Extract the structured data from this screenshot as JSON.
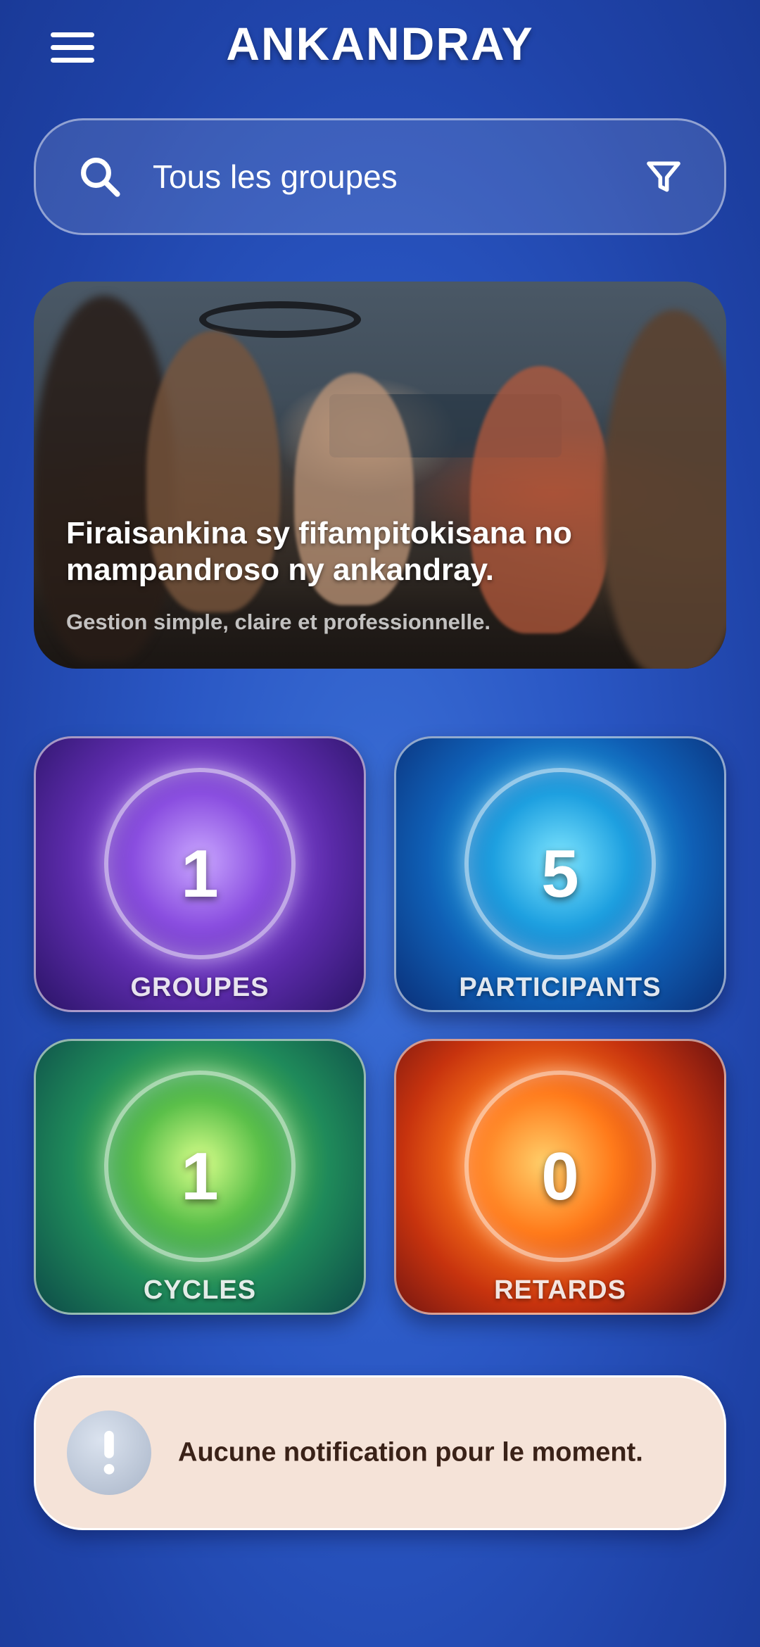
{
  "header": {
    "title": "ANKANDRAY",
    "menu_icon": "hamburger-menu-icon"
  },
  "search": {
    "placeholder": "Tous les groupes",
    "search_icon": "search-icon",
    "filter_icon": "filter-icon"
  },
  "hero": {
    "title": "Firaisankina sy fifampitokisana no mampandroso ny ankandray.",
    "subtitle": "Gestion simple, claire et professionnelle."
  },
  "stats": [
    {
      "value": "1",
      "label": "GROUPES",
      "icon": "group-people-icon",
      "color": "#7a3fd6"
    },
    {
      "value": "5",
      "label": "PARTICIPANTS",
      "icon": "person-icon",
      "color": "#1a8fd8"
    },
    {
      "value": "1",
      "label": "CYCLES",
      "icon": "cycle-arrows-icon",
      "color": "#3aa84a"
    },
    {
      "value": "0",
      "label": "RETARDS",
      "icon": "hourglass-clock-icon",
      "color": "#e8501a"
    }
  ],
  "notification": {
    "text": "Aucune notification pour le moment.",
    "icon": "alert-icon"
  },
  "colors": {
    "background": "#2a57c4",
    "notification_bg": "#f5e3d8",
    "notification_text": "#3a2218"
  }
}
